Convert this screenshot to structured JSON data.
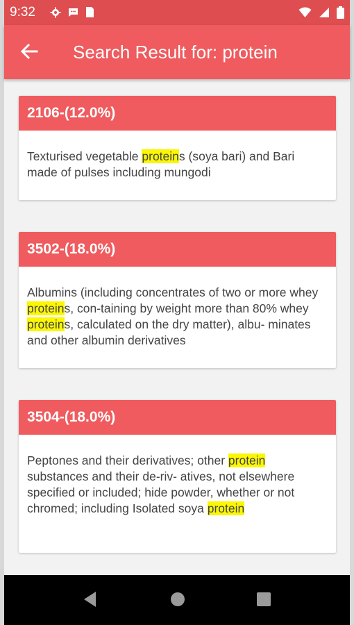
{
  "status_bar": {
    "time": "9:32",
    "left_icons": [
      "gear-icon",
      "chat-icon",
      "sim-icon"
    ],
    "right_icons": [
      "wifi-icon",
      "signal-icon",
      "battery-icon"
    ]
  },
  "app_bar": {
    "title": "Search Result for: protein",
    "back_icon": "arrow-back-icon"
  },
  "results": [
    {
      "code": "2106-(12.0%)",
      "segments": [
        {
          "t": "Texturised vegetable "
        },
        {
          "t": "protein",
          "hl": true
        },
        {
          "t": "s (soya bari) and Bari made of pulses including mungodi"
        }
      ]
    },
    {
      "code": "3502-(18.0%)",
      "segments": [
        {
          "t": "Albumins (including concentrates of two or more whey "
        },
        {
          "t": "protein",
          "hl": true
        },
        {
          "t": "s, con-taining by weight more than 80% whey "
        },
        {
          "t": "protein",
          "hl": true
        },
        {
          "t": "s, calculated on the dry matter), albu- minates and other albumin derivatives"
        }
      ]
    },
    {
      "code": "3504-(18.0%)",
      "segments": [
        {
          "t": "Peptones and their derivatives; other "
        },
        {
          "t": "protein",
          "hl": true
        },
        {
          "t": " substances and their de-riv- atives, not elsewhere specified or included; hide powder, whether or not chromed; including Isolated soya "
        },
        {
          "t": "protein",
          "hl": true
        }
      ]
    }
  ],
  "colors": {
    "app_bar": "#ef5b5e",
    "status_bar": "#de4d50",
    "highlight": "#fbf704"
  },
  "nav_bar": {
    "buttons": [
      "back-triangle-icon",
      "home-circle-icon",
      "recents-square-icon"
    ]
  }
}
